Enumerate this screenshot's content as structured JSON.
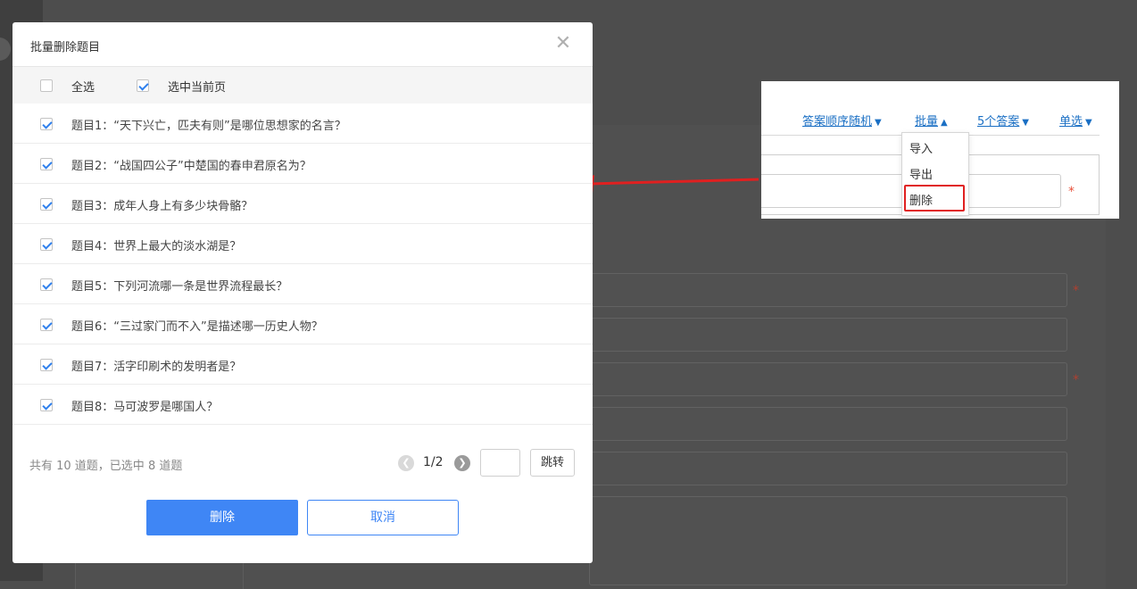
{
  "modal": {
    "title": "批量删除题目",
    "select_all_label": "全选",
    "select_page_label": "选中当前页",
    "questions": [
      {
        "text": "题目1：“天下兴亡，匹夫有则”是哪位思想家的名言？",
        "checked": true
      },
      {
        "text": "题目2：“战国四公子”中楚国的春申君原名为？",
        "checked": true
      },
      {
        "text": "题目3：成年人身上有多少块骨骼？",
        "checked": true
      },
      {
        "text": "题目4：世界上最大的淡水湖是？",
        "checked": true
      },
      {
        "text": "题目5：下列河流哪一条是世界流程最长？",
        "checked": true
      },
      {
        "text": "题目6：“三过家门而不入”是描述哪一历史人物？",
        "checked": true
      },
      {
        "text": "题目7：活字印刷术的发明者是？",
        "checked": true
      },
      {
        "text": "题目8：马可波罗是哪国人？",
        "checked": true
      }
    ],
    "summary": "共有 10 道题，已选中 8 道题",
    "page_indicator": "1/2",
    "jump_label": "跳转",
    "delete_label": "删除",
    "cancel_label": "取消"
  },
  "callout": {
    "links": {
      "answer_order": "答案顺序随机",
      "batch": "批量",
      "answer_count": "5个答案",
      "single_choice": "单选"
    },
    "dropdown": [
      "导入",
      "导出",
      "删除"
    ],
    "required_mark": "*"
  },
  "colors": {
    "primary": "#3f86f5",
    "link": "#1a6fc4",
    "highlight": "#e02020"
  }
}
